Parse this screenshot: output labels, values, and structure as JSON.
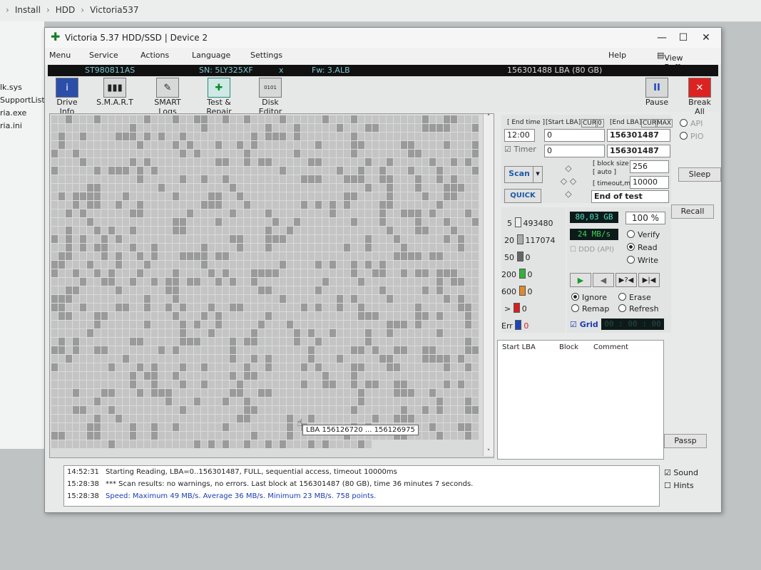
{
  "explorer": {
    "crumbs": [
      "Install",
      "HDD",
      "Victoria537"
    ],
    "files": [
      "lk.sys",
      "SupportList.rtf",
      "ria.exe",
      "ria.ini"
    ]
  },
  "window": {
    "title": "Victoria 5.37 HDD/SSD | Device 2",
    "minimize": "—",
    "maximize": "☐",
    "close": "✕"
  },
  "menu": {
    "items": [
      "Menu",
      "Service",
      "Actions",
      "Language",
      "Settings"
    ],
    "help": "Help",
    "view_buffer": "View Buffer Live"
  },
  "device": {
    "model": "ST980811AS",
    "serial": "SN: 5LY325XF",
    "x": "x",
    "firmware": "Fw: 3.ALB",
    "capacity": "156301488 LBA (80 GB)"
  },
  "toolbar": {
    "drive_info": "Drive Info",
    "smart": "S.M.A.R.T",
    "smart_logs": "SMART Logs",
    "test_repair": "Test & Repair",
    "disk_editor": "Disk Editor",
    "pause": "Pause",
    "break_all": "Break All"
  },
  "test": {
    "end_time_label": "[ End time ]",
    "start_lba_label": "[Start LBA]",
    "cur": "CUR",
    "cur_val": "0",
    "end_lba_label": "[End LBA]",
    "cur2": "CUR",
    "max": "MAX",
    "time": "12:00",
    "start_lba": "0",
    "end_lba": "156301487",
    "timer": "Timer",
    "timer_val": "0",
    "end_lba2": "156301487",
    "scan": "Scan",
    "quick": "QUICK",
    "block_size_label": "[ block size ]",
    "auto_label": "[ auto ]",
    "block_size": "256",
    "timeout_label": "[ timeout,ms ]",
    "timeout": "10000",
    "end_of_test": "End of test"
  },
  "stats": {
    "c5": "493480",
    "c20": "117074",
    "c50": "0",
    "c200": "0",
    "c600": "0",
    "cgt": "0",
    "cerr": "0",
    "l5": "5",
    "l20": "20",
    "l50": "50",
    "l200": "200",
    "l600": "600",
    "lgt": ">",
    "lerr": "Err"
  },
  "progress": {
    "size": "80,03 GB",
    "percent": "100",
    "pct_sign": "%",
    "speed": "24 MB/s",
    "ddd": "DDD (API)",
    "verify": "Verify",
    "read": "Read",
    "write": "Write",
    "ignore": "Ignore",
    "erase": "Erase",
    "remap": "Remap",
    "refresh": "Refresh",
    "grid": "Grid",
    "elapsed": "00 : 00 : 00"
  },
  "results": {
    "cols": [
      "Start LBA",
      "Block",
      "Comment"
    ]
  },
  "side": {
    "api": "API",
    "pio": "PIO",
    "sleep": "Sleep",
    "recall": "Recall",
    "passp": "Passp",
    "sound": "Sound",
    "hints": "Hints"
  },
  "tooltip": "LBA  156126720 ... 156126975",
  "log": [
    {
      "time": "14:52:31",
      "msg": "Starting Reading, LBA=0..156301487, FULL, sequential access, timeout 10000ms"
    },
    {
      "time": "15:28:38",
      "msg": "*** Scan results: no warnings, no errors. Last block at 156301487 (80 GB), time 36 minutes 7 seconds."
    },
    {
      "time": "15:28:38",
      "msg": "Speed: Maximum 49 MB/s. Average 36 MB/s. Minimum 23 MB/s. 758 points."
    }
  ],
  "colors": {
    "green": "#2fb43a",
    "orange": "#e08a2a",
    "red": "#d62020",
    "blue": "#1e46b8",
    "speed_text": "#1c3cb0"
  }
}
